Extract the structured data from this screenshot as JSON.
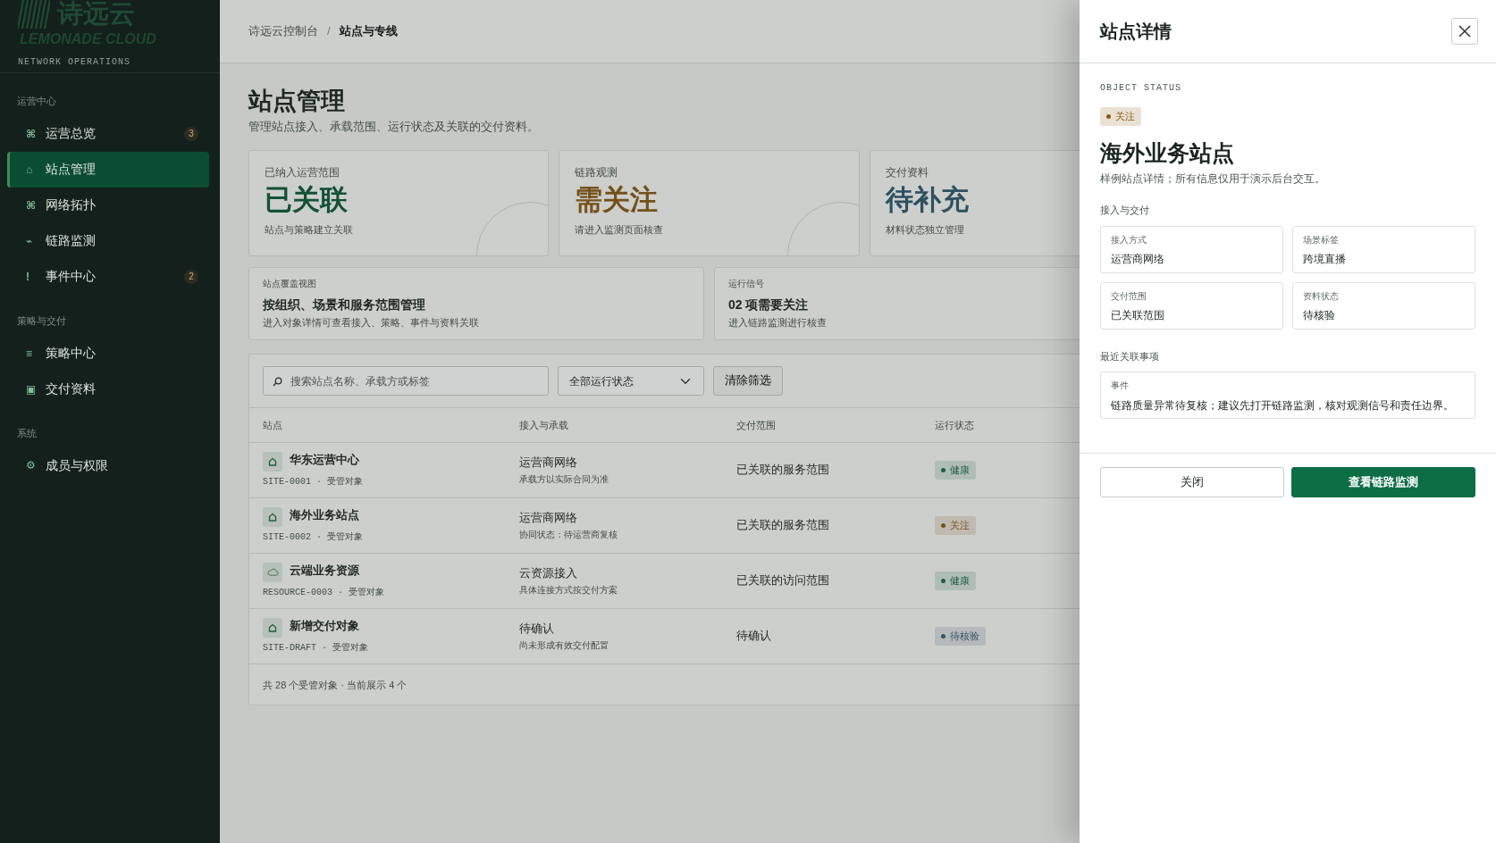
{
  "brand": {
    "name": "诗远云",
    "name_en": "LEMONADE CLOUD",
    "subtitle": "NETWORK OPERATIONS"
  },
  "sidebar": {
    "groups": [
      {
        "label": "运营中心",
        "items": [
          {
            "icon": "⌘",
            "label": "运营总览",
            "count": "3",
            "selected": false
          },
          {
            "icon": "⌂",
            "label": "站点管理",
            "selected": true
          },
          {
            "icon": "⌘",
            "label": "网络拓扑",
            "selected": false
          },
          {
            "icon": "⌁",
            "label": "链路监测",
            "selected": false
          },
          {
            "icon": "!",
            "label": "事件中心",
            "count": "2",
            "selected": false
          }
        ]
      },
      {
        "label": "策略与交付",
        "items": [
          {
            "icon": "≡",
            "label": "策略中心",
            "selected": false
          },
          {
            "icon": "▣",
            "label": "交付资料",
            "selected": false
          }
        ]
      },
      {
        "label": "系统",
        "items": [
          {
            "icon": "⚙",
            "label": "成员与权限",
            "selected": false
          }
        ]
      }
    ]
  },
  "breadcrumb": {
    "separator": "/",
    "items": [
      {
        "label": "诗远云控制台",
        "current": false
      },
      {
        "label": "站点与专线",
        "current": true
      }
    ]
  },
  "page": {
    "title": "站点管理",
    "subtitle": "管理站点接入、承载范围、运行状态及关联的交付资料。"
  },
  "stat_cards": [
    {
      "label": "已纳入运营范围",
      "value": "已关联",
      "note": "站点与策略建立关联",
      "kind": "ok"
    },
    {
      "label": "链路观测",
      "value": "需关注",
      "note": "请进入监测页面核查",
      "kind": "warning"
    },
    {
      "label": "交付资料",
      "value": "待补充",
      "note": "材料状态独立管理",
      "kind": "pending"
    }
  ],
  "info_cards": [
    {
      "label": "站点覆盖视图",
      "title": "按组织、场景和服务范围管理",
      "note": "进入对象详情可查看接入、策略、事件与资料关联"
    },
    {
      "label": "运行信号",
      "title": "02 项需要关注",
      "note": "进入链路监测进行核查"
    }
  ],
  "filters": {
    "search": {
      "placeholder": "搜索站点名称、承载方或标签"
    },
    "status_select": "全部运行状态",
    "clear_button": "清除筛选"
  },
  "table": {
    "columns": [
      "站点",
      "接入与承载",
      "交付范围",
      "运行状态"
    ],
    "rows": [
      {
        "kind": "site",
        "name": "华东运营中心",
        "meta": "SITE-0001 · 受管对象",
        "access": "运营商网络",
        "access_note": "承载方以实际合同为准",
        "scope": "已关联的服务范围",
        "status": {
          "label": "健康",
          "color": "#1f5f40"
        }
      },
      {
        "kind": "site",
        "name": "海外业务站点",
        "meta": "SITE-0002 · 受管对象",
        "access": "运营商网络",
        "access_note": "协同状态：待运营商复核",
        "scope": "已关联的服务范围",
        "status": {
          "label": "关注",
          "color": "#74521a"
        }
      },
      {
        "kind": "cloud",
        "name": "云端业务资源",
        "meta": "RESOURCE-0003 · 受管对象",
        "access": "云资源接入",
        "access_note": "具体连接方式按交付方案",
        "scope": "已关联的访问范围",
        "status": {
          "label": "健康",
          "color": "#1f5f40"
        }
      },
      {
        "kind": "site",
        "name": "新增交付对象",
        "meta": "SITE-DRAFT · 受管对象",
        "access": "待确认",
        "access_note": "尚未形成有效交付配置",
        "scope": "待确认",
        "status": {
          "label": "待核验",
          "color": "#365261"
        }
      }
    ],
    "footer": "共 28 个受管对象 · 当前展示 4 个"
  },
  "drawer": {
    "title": "站点详情",
    "kicker": "OBJECT STATUS",
    "status": {
      "label": "关注",
      "color": "#8a5a14"
    },
    "heading": "海外业务站点",
    "description": "样例站点详情；所有信息仅用于演示后台交互。",
    "section_fields": "接入与交付",
    "fields": [
      {
        "label": "接入方式",
        "value": "运营商网络"
      },
      {
        "label": "场景标签",
        "value": "跨境直播"
      },
      {
        "label": "交付范围",
        "value": "已关联范围"
      },
      {
        "label": "资料状态",
        "value": "待核验"
      }
    ],
    "section_events": "最近关联事项",
    "event": {
      "label": "事件",
      "text": "链路质量异常待复核；建议先打开链路监测，核对观测信号和责任边界。"
    },
    "buttons": [
      {
        "label": "关闭",
        "kind": "secondary"
      },
      {
        "label": "查看链路监测",
        "kind": "primary"
      }
    ]
  }
}
